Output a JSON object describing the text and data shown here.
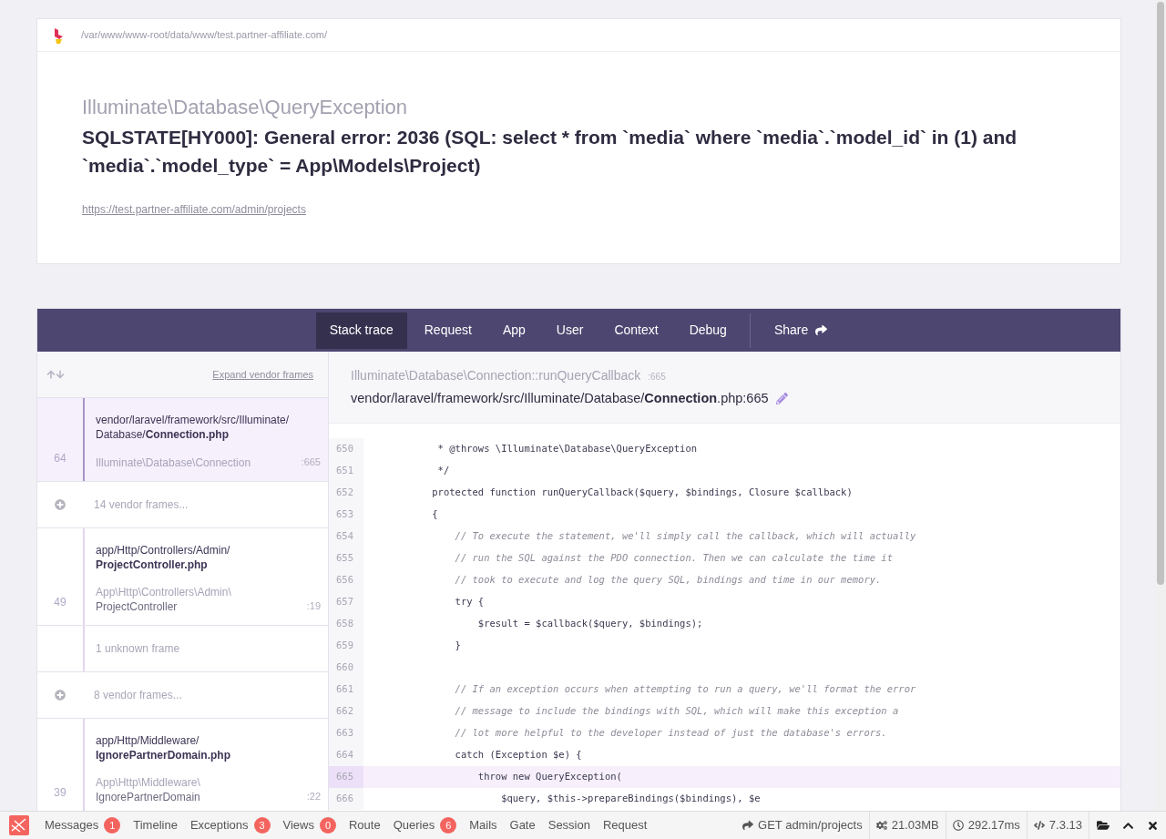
{
  "header": {
    "path": "/var/www/www-root/data/www/test.partner-affiliate.com/",
    "exception_class": "Illuminate\\Database\\QueryException",
    "message": "SQLSTATE[HY000]: General error: 2036 (SQL: select * from `media` where `media`.`model_id` in (1) and `media`.`model_type` = App\\Models\\Project)",
    "url": "https://test.partner-affiliate.com/admin/projects"
  },
  "tabs": [
    {
      "label": "Stack trace",
      "selected": true
    },
    {
      "label": "Request",
      "selected": false
    },
    {
      "label": "App",
      "selected": false
    },
    {
      "label": "User",
      "selected": false
    },
    {
      "label": "Context",
      "selected": false
    },
    {
      "label": "Debug",
      "selected": false
    }
  ],
  "share": {
    "label": "Share"
  },
  "frames_toolbar": {
    "expand": "Expand vendor frames"
  },
  "frames": [
    {
      "kind": "app",
      "selected": true,
      "number": "64",
      "file_lines": [
        "vendor/laravel/framework/src/Illuminate/",
        "Database/**Connection.php**"
      ],
      "class_lines": [
        "Illuminate\\Database\\Connection"
      ],
      "line": ":665"
    },
    {
      "kind": "vendor",
      "selected": false,
      "text": "14 vendor frames..."
    },
    {
      "kind": "app",
      "selected": false,
      "number": "49",
      "file_lines": [
        "app/Http/Controllers/Admin/",
        "**ProjectController.php**"
      ],
      "class_lines": [
        "App\\Http\\Controllers\\Admin\\",
        "ProjectController"
      ],
      "line": ":19"
    },
    {
      "kind": "unknown",
      "selected": false,
      "text": "1 unknown frame"
    },
    {
      "kind": "vendor",
      "selected": false,
      "text": "8 vendor frames..."
    },
    {
      "kind": "app",
      "selected": false,
      "number": "39",
      "file_lines": [
        "app/Http/Middleware/",
        "**IgnorePartnerDomain.php**"
      ],
      "class_lines": [
        "App\\Http\\Middleware\\",
        "IgnorePartnerDomain"
      ],
      "line": ":22"
    }
  ],
  "code_header": {
    "method": "Illuminate\\Database\\Connection::runQueryCallback",
    "line": ":665",
    "file": "vendor/laravel/framework/src/Illuminate/Database/**Connection**.php:665"
  },
  "code_lines": [
    {
      "number": "650",
      "kind": "code",
      "text": "     * @throws \\Illuminate\\Database\\QueryException",
      "selected": false
    },
    {
      "number": "651",
      "kind": "code",
      "text": "     */",
      "selected": false
    },
    {
      "number": "652",
      "kind": "code",
      "text": "    protected function runQueryCallback($query, $bindings, Closure $callback)",
      "selected": false
    },
    {
      "number": "653",
      "kind": "code",
      "text": "    {",
      "selected": false
    },
    {
      "number": "654",
      "kind": "comment",
      "text": "        // To execute the statement, we'll simply call the callback, which will actually",
      "selected": false
    },
    {
      "number": "655",
      "kind": "comment",
      "text": "        // run the SQL against the PDO connection. Then we can calculate the time it",
      "selected": false
    },
    {
      "number": "656",
      "kind": "comment",
      "text": "        // took to execute and log the query SQL, bindings and time in our memory.",
      "selected": false
    },
    {
      "number": "657",
      "kind": "code",
      "text": "        try {",
      "selected": false
    },
    {
      "number": "658",
      "kind": "code",
      "text": "            $result = $callback($query, $bindings);",
      "selected": false
    },
    {
      "number": "659",
      "kind": "code",
      "text": "        }",
      "selected": false
    },
    {
      "number": "660",
      "kind": "blank",
      "selected": false
    },
    {
      "number": "661",
      "kind": "comment",
      "text": "        // If an exception occurs when attempting to run a query, we'll format the error",
      "selected": false
    },
    {
      "number": "662",
      "kind": "comment",
      "text": "        // message to include the bindings with SQL, which will make this exception a",
      "selected": false
    },
    {
      "number": "663",
      "kind": "comment",
      "text": "        // lot more helpful to the developer instead of just the database's errors.",
      "selected": false
    },
    {
      "number": "664",
      "kind": "code",
      "text": "        catch (Exception $e) {",
      "selected": false
    },
    {
      "number": "665",
      "kind": "code",
      "text": "            throw new QueryException(",
      "selected": true
    },
    {
      "number": "666",
      "kind": "code",
      "text": "                $query, $this->prepareBindings($bindings), $e",
      "selected": false
    }
  ],
  "debugbar": {
    "tabs": [
      {
        "label": "Messages",
        "badge": "1"
      },
      {
        "label": "Timeline"
      },
      {
        "label": "Exceptions",
        "badge": "3"
      },
      {
        "label": "Views",
        "badge": "0"
      },
      {
        "label": "Route"
      },
      {
        "label": "Queries",
        "badge": "6"
      },
      {
        "label": "Mails"
      },
      {
        "label": "Gate"
      },
      {
        "label": "Session"
      },
      {
        "label": "Request"
      }
    ],
    "stats": [
      {
        "kind": "request",
        "text": "GET admin/projects"
      },
      {
        "kind": "memory",
        "text": "21.03MB"
      },
      {
        "kind": "time",
        "text": "292.17ms"
      },
      {
        "kind": "version",
        "text": "7.3.13"
      }
    ]
  }
}
